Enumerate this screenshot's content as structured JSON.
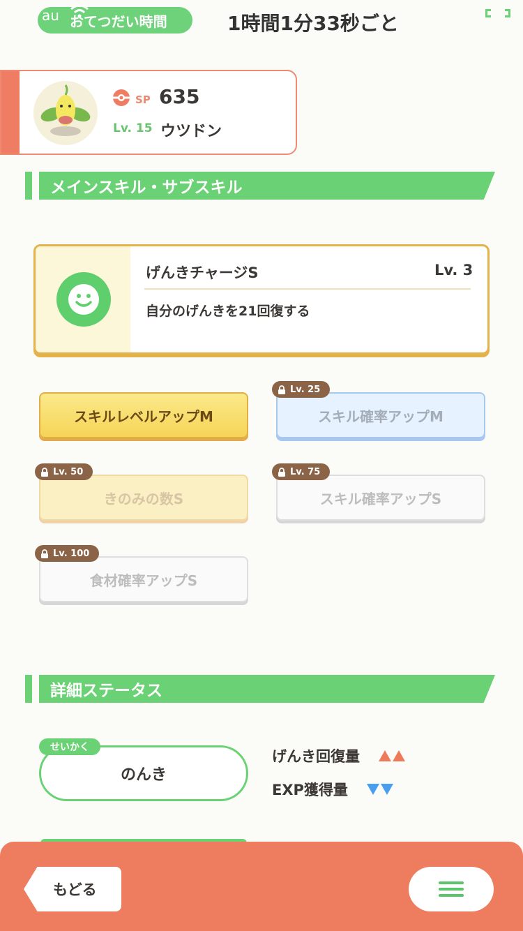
{
  "status_bar": {
    "carrier": "au",
    "helper_time_label": "おてつだい時間",
    "helper_time_value": "1時間1分33秒ごと"
  },
  "pokemon": {
    "sp_label": "SP",
    "sp_value": "635",
    "level": "Lv. 15",
    "name": "ウツドン"
  },
  "sections": {
    "skills_title": "メインスキル・サブスキル",
    "status_title": "詳細ステータス"
  },
  "main_skill": {
    "name": "げんきチャージS",
    "level": "Lv. 3",
    "description": "自分のげんきを21回復する",
    "icon": "smile-face-icon"
  },
  "sub_skills": [
    {
      "label": "スキルレベルアップM",
      "lock_level": "",
      "style": "gold"
    },
    {
      "label": "スキル確率アップM",
      "lock_level": "Lv. 25",
      "style": "blue"
    },
    {
      "label": "きのみの数S",
      "lock_level": "Lv. 50",
      "style": "cream"
    },
    {
      "label": "スキル確率アップS",
      "lock_level": "Lv. 75",
      "style": "white"
    },
    {
      "label": "食材確率アップS",
      "lock_level": "Lv. 100",
      "style": "white"
    }
  ],
  "nature": {
    "tag": "せいかく",
    "value": "のんき",
    "effects": [
      {
        "label": "げんき回復量",
        "direction": "up",
        "color": "#ef7a5a"
      },
      {
        "label": "EXP獲得量",
        "direction": "down",
        "color": "#4a9ef0"
      }
    ]
  },
  "footer": {
    "back_label": "もどる",
    "menu_icon": "hamburger-menu-icon"
  },
  "colors": {
    "accent_green": "#6ad275",
    "footer_orange": "#ee7c5e",
    "gold": "#e3b24a"
  }
}
